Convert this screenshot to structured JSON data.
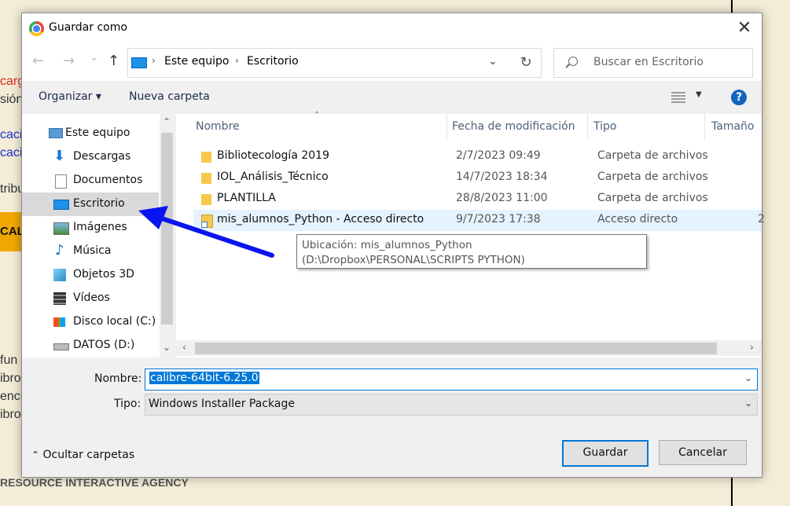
{
  "background": {
    "fragments": [
      {
        "text": "carg",
        "kind": "red"
      },
      {
        "text": "sión",
        "kind": "dark"
      },
      {
        "text": "caci",
        "kind": "blue"
      },
      {
        "text": "caci",
        "kind": "blue"
      },
      {
        "text": "tribu",
        "kind": "dark"
      },
      {
        "text": "fun",
        "kind": "dark"
      },
      {
        "text": "ibro",
        "kind": "dark"
      },
      {
        "text": "enci",
        "kind": "dark"
      },
      {
        "text": "ibro",
        "kind": "dark"
      }
    ],
    "banner_text": "CAL",
    "footer": "RESOURCE INTERACTIVE AGENCY"
  },
  "dialog": {
    "title": "Guardar como",
    "close_icon": "close-icon",
    "nav": {
      "back_icon": "←",
      "forward_icon": "→",
      "dropdown_icon": "⌄",
      "up_icon": "↑",
      "breadcrumb": [
        "Este equipo",
        "Escritorio"
      ],
      "refresh_icon": "↻",
      "search_placeholder": "Buscar en Escritorio"
    },
    "toolbar": {
      "organize": "Organizar ▾",
      "new_folder": "Nueva carpeta",
      "help": "?"
    },
    "sidebar": {
      "items": [
        {
          "label": "Este equipo",
          "icon": "computer-icon"
        },
        {
          "label": "Descargas",
          "icon": "download-icon"
        },
        {
          "label": "Documentos",
          "icon": "documents-icon"
        },
        {
          "label": "Escritorio",
          "icon": "desktop-icon",
          "selected": true
        },
        {
          "label": "Imágenes",
          "icon": "pictures-icon"
        },
        {
          "label": "Música",
          "icon": "music-icon"
        },
        {
          "label": "Objetos 3D",
          "icon": "objects3d-icon"
        },
        {
          "label": "Vídeos",
          "icon": "videos-icon"
        },
        {
          "label": "Disco local (C:)",
          "icon": "drive-icon"
        },
        {
          "label": "DATOS (D:)",
          "icon": "drive-icon"
        }
      ]
    },
    "files": {
      "columns": [
        "Nombre",
        "Fecha de modificación",
        "Tipo",
        "Tamaño"
      ],
      "rows": [
        {
          "name": "Bibliotecología 2019",
          "date": "2/7/2023 09:49",
          "type": "Carpeta de archivos",
          "size": "",
          "icon": "folder-icon"
        },
        {
          "name": "IOL_Análisis_Técnico",
          "date": "14/7/2023 18:34",
          "type": "Carpeta de archivos",
          "size": "",
          "icon": "folder-icon"
        },
        {
          "name": "PLANTILLA",
          "date": "28/8/2023 11:00",
          "type": "Carpeta de archivos",
          "size": "",
          "icon": "folder-icon"
        },
        {
          "name": "mis_alumnos_Python - Acceso directo",
          "date": "9/7/2023 17:38",
          "type": "Acceso directo",
          "size": "2",
          "icon": "shortcut-icon",
          "selected": true
        }
      ],
      "tooltip": "Ubicación: mis_alumnos_Python (D:\\Dropbox\\PERSONAL\\SCRIPTS PYTHON)"
    },
    "form": {
      "name_label": "Nombre:",
      "name_value": "calibre-64bit-6.25.0",
      "type_label": "Tipo:",
      "type_value": "Windows Installer Package"
    },
    "footer": {
      "hide_folders": "Ocultar carpetas",
      "save": "Guardar",
      "cancel": "Cancelar"
    }
  },
  "annotation": {
    "arrow_color": "#0a14f0"
  }
}
